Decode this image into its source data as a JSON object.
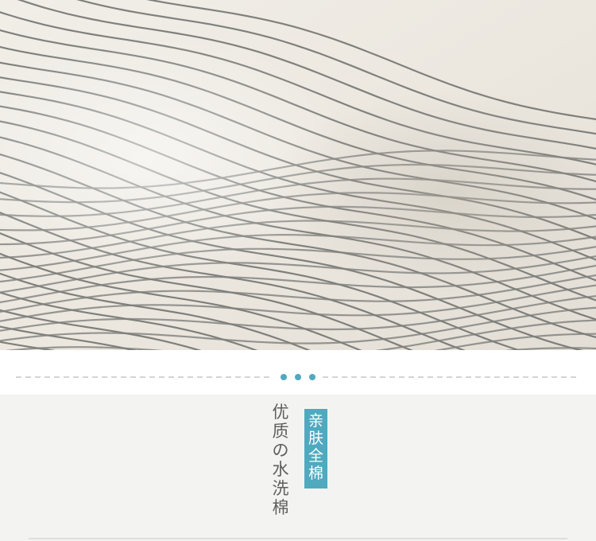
{
  "photo": {
    "subject": "striped-duvet"
  },
  "divider": {
    "dot_color": "#4fa9bf",
    "dash_color": "#b9b9b9"
  },
  "feature": {
    "title": "优质の水洗棉",
    "badge": "亲肤全棉",
    "badge_color": "#4fa9bf",
    "background": "#f3f4f2"
  }
}
